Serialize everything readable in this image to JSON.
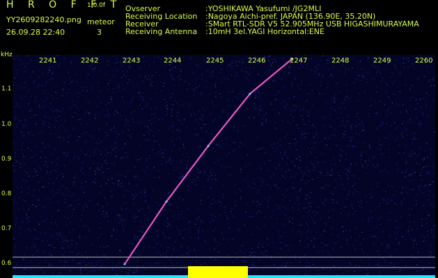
{
  "header": {
    "app_title": "H R O F F T",
    "version": "1.0.0f",
    "filename": "YY2609282240.png",
    "mode": "meteor",
    "timestamp": "26.09.28 22:40",
    "count": "3"
  },
  "station_info": [
    {
      "key": "Ovserver",
      "value": ":YOSHIKAWA Yasufumi /JG2MLI"
    },
    {
      "key": "Receiving Location",
      "value": ":Nagoya Aichi-pref. JAPAN (136.90E, 35.20N)"
    },
    {
      "key": "Receiver",
      "value": ":SMart RTL-SDR V5 52.905MHz USB HIGASHIMURAYAMA"
    },
    {
      "key": "Receiving Antenna",
      "value": ":10mH 3el.YAGI Horizontal:ENE"
    }
  ],
  "chart_data": {
    "type": "heatmap",
    "xlabel": "",
    "ylabel": "kHz",
    "x_ticks": [
      "2241",
      "2242",
      "2243",
      "2244",
      "2245",
      "2246",
      "2247",
      "2248",
      "2249",
      "2260"
    ],
    "y_ticks": [
      "1.1",
      "1.0",
      "0.9",
      "0.8",
      "0.7",
      "0.6"
    ],
    "trace": {
      "description_color": "#ff5bd6",
      "points": [
        {
          "time": "2243",
          "khz": 0.6
        },
        {
          "time": "2244",
          "khz": 0.78
        },
        {
          "time": "2245",
          "khz": 0.94
        },
        {
          "time": "2246",
          "khz": 1.09
        },
        {
          "time": "2247",
          "khz": 1.19
        }
      ]
    },
    "colors": {
      "background": "#040526",
      "noise": "#2a2fb8",
      "baseline": "#22e5ff",
      "marker": "#ffff00",
      "guide_lines": "#bdbdbd",
      "text": "#d8ff4a"
    }
  }
}
